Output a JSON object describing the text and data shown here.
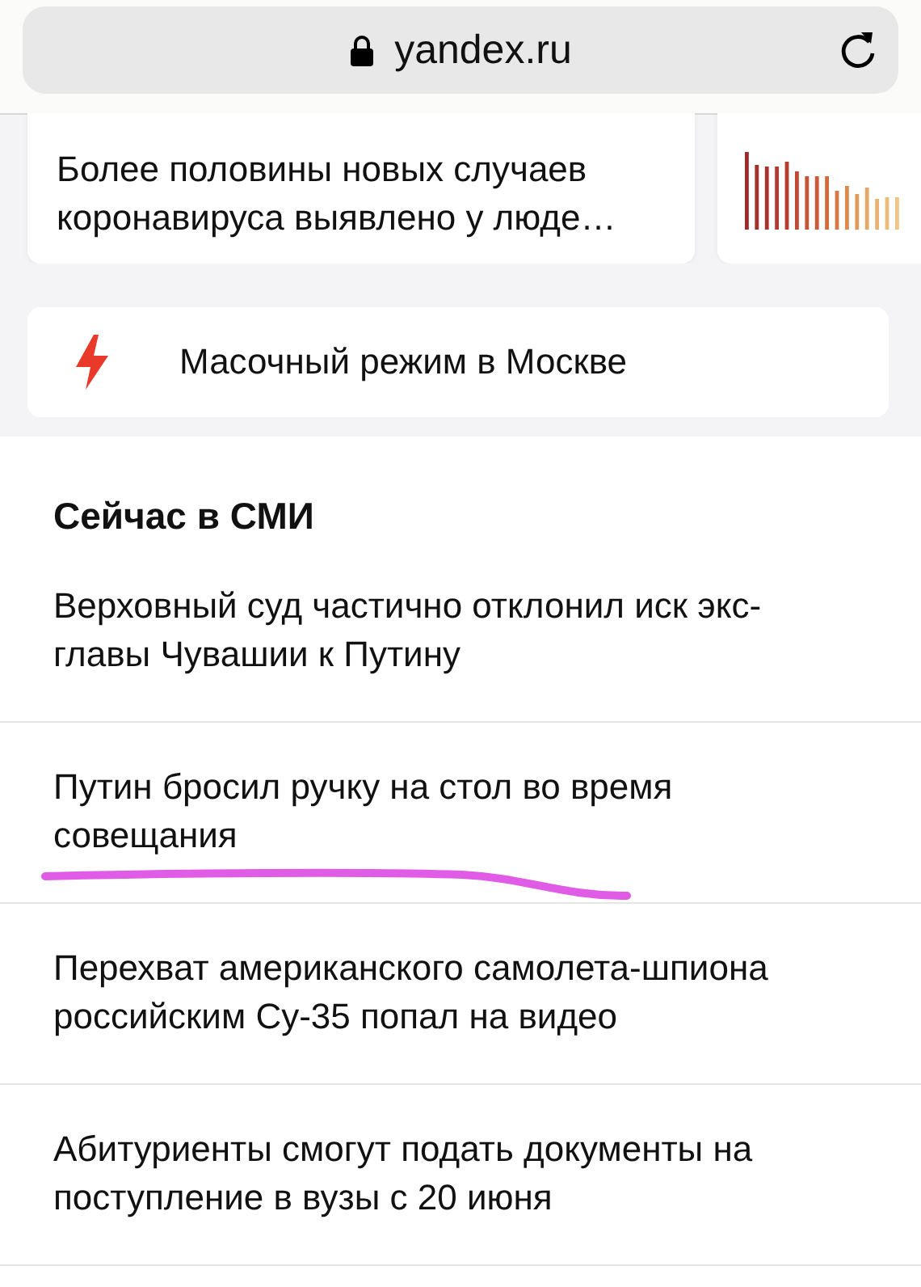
{
  "address_bar": {
    "url": "yandex.ru",
    "secure": true
  },
  "story_cards": [
    {
      "kind": "text",
      "headline": "Более половины новых случаев коронавируса выявлено у люде…"
    },
    {
      "kind": "chart"
    }
  ],
  "alert": {
    "text": "Масочный режим в Москве"
  },
  "media_section": {
    "title": "Сейчас в СМИ",
    "items": [
      {
        "headline": "Верховный суд частично отклонил иск экс-главы Чувашии к Путину",
        "underlined": false
      },
      {
        "headline": "Путин бросил ручку на стол во время совещания",
        "underlined": true
      },
      {
        "headline": "Перехват американского самолета-шпиона российским Су-35 попал на видео",
        "underlined": false
      },
      {
        "headline": "Абитуриенты смогут подать документы на поступление в вузы с 20 июня",
        "underlined": false
      }
    ]
  }
}
